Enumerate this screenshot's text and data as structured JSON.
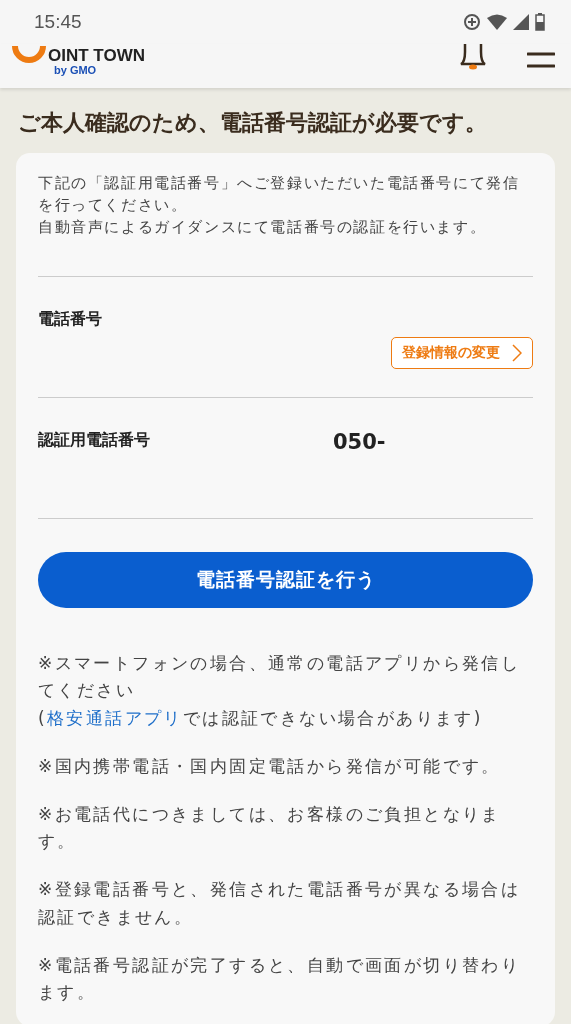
{
  "status_bar": {
    "time": "15:45"
  },
  "header": {
    "logo_text": "OINT TOWN",
    "logo_sub": "by GMO"
  },
  "title": "ご本人確認のため、電話番号認証が必要です。",
  "card": {
    "intro": [
      "下記の「認証用電話番号」へご登録いただいた電話番号にて発信を行ってください。",
      "自動音声によるガイダンスにて電話番号の認証を行います。"
    ],
    "fields": [
      {
        "label": "電話番号",
        "kind": "action",
        "action": "登録情報の変更"
      },
      {
        "label": "認証用電話番号",
        "kind": "value",
        "value": "050-"
      }
    ],
    "submit": "電話番号認証を行う",
    "notes": [
      {
        "text": "※スマートフォンの場合、通常の電話アプリから発信してください",
        "before": "(",
        "link": "格安通話アプリ",
        "after": "では認証できない場合があります)"
      },
      {
        "text": "※国内携帯電話・国内固定電話から発信が可能です。"
      },
      {
        "text": "※お電話代につきましては、お客様のご負担となります。"
      },
      {
        "text": "※登録電話番号と、発信された電話番号が異なる場合は認証できません。"
      },
      {
        "text": "※電話番号認証が完了すると、自動で画面が切り替わります。"
      }
    ]
  }
}
